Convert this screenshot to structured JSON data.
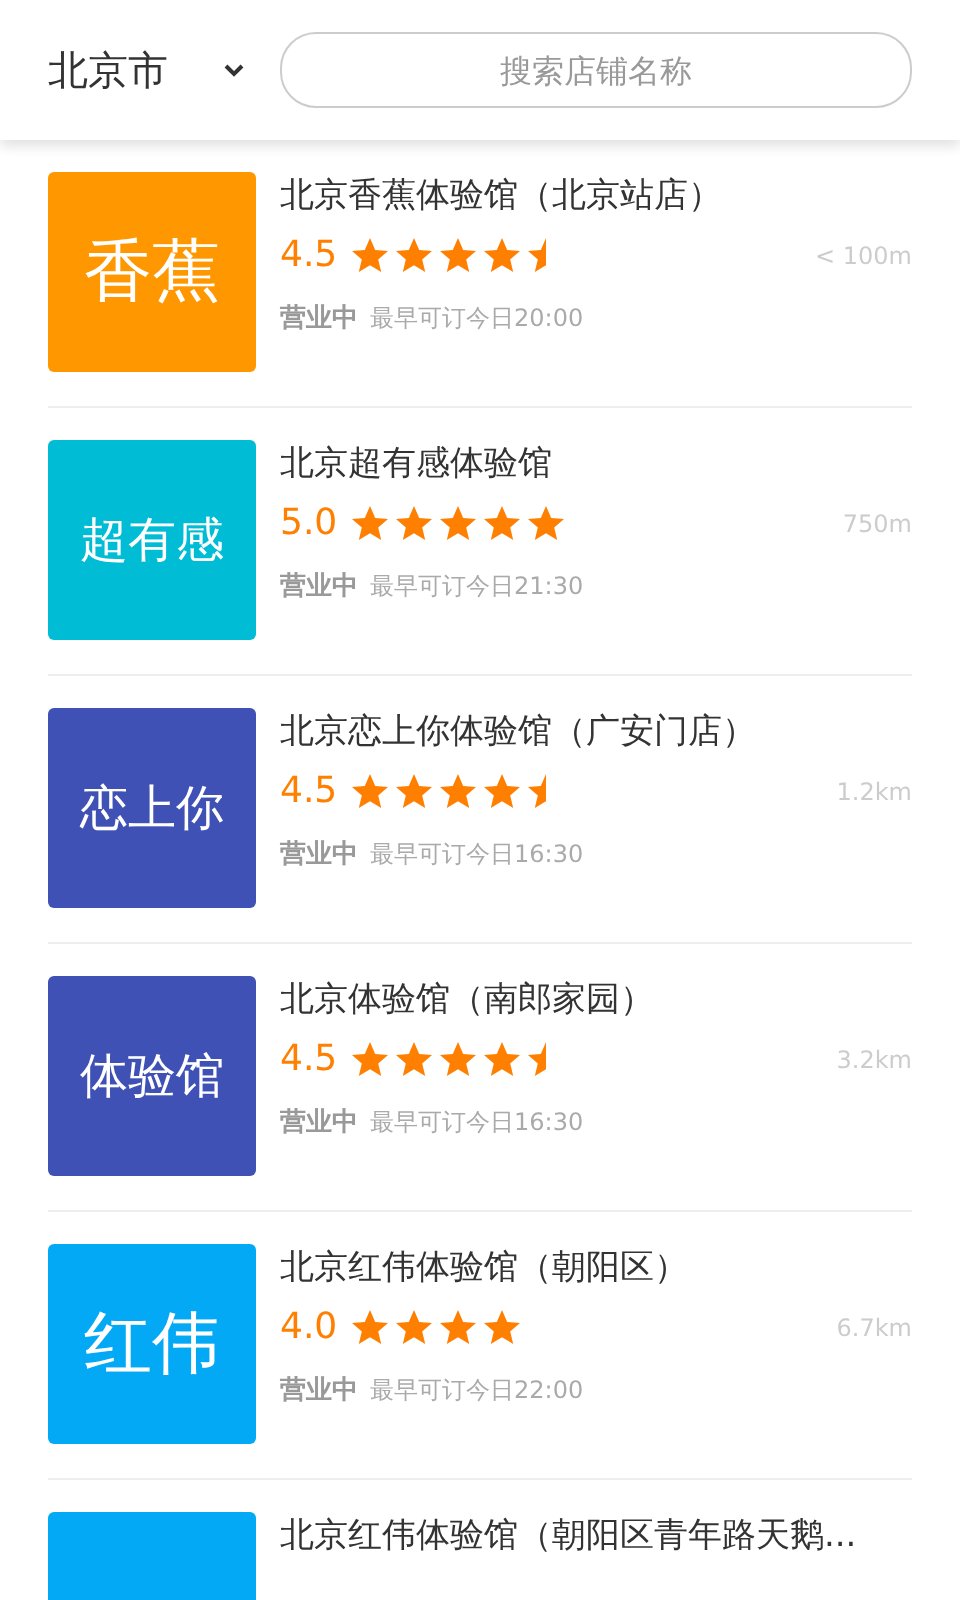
{
  "header": {
    "city": "北京市",
    "search": {
      "placeholder": "搜索店铺名称"
    }
  },
  "stores": [
    {
      "logo_text": "香蕉",
      "color": "#ff9800",
      "name": "北京香蕉体验馆（北京站店）",
      "rating": "4.5",
      "stars": 4.5,
      "distance": "< 100m",
      "status": "营业中",
      "booking": "最早可订今日20:00"
    },
    {
      "logo_text": "超有感",
      "color": "#00bcd4",
      "name": "北京超有感体验馆",
      "rating": "5.0",
      "stars": 5,
      "distance": "750m",
      "status": "营业中",
      "booking": "最早可订今日21:30"
    },
    {
      "logo_text": "恋上你",
      "color": "#3f51b5",
      "name": "北京恋上你体验馆（广安门店）",
      "rating": "4.5",
      "stars": 4.5,
      "distance": "1.2km",
      "status": "营业中",
      "booking": "最早可订今日16:30"
    },
    {
      "logo_text": "体验馆",
      "color": "#3f51b5",
      "name": "北京体验馆（南郎家园）",
      "rating": "4.5",
      "stars": 4.5,
      "distance": "3.2km",
      "status": "营业中",
      "booking": "最早可订今日16:30"
    },
    {
      "logo_text": "红伟",
      "color": "#03a9f4",
      "name": "北京红伟体验馆（朝阳区）",
      "rating": "4.0",
      "stars": 4,
      "distance": "6.7km",
      "status": "营业中",
      "booking": "最早可订今日22:00"
    },
    {
      "color": "#03a9f4",
      "name": "北京红伟体验馆（朝阳区青年路天鹅..."
    }
  ]
}
